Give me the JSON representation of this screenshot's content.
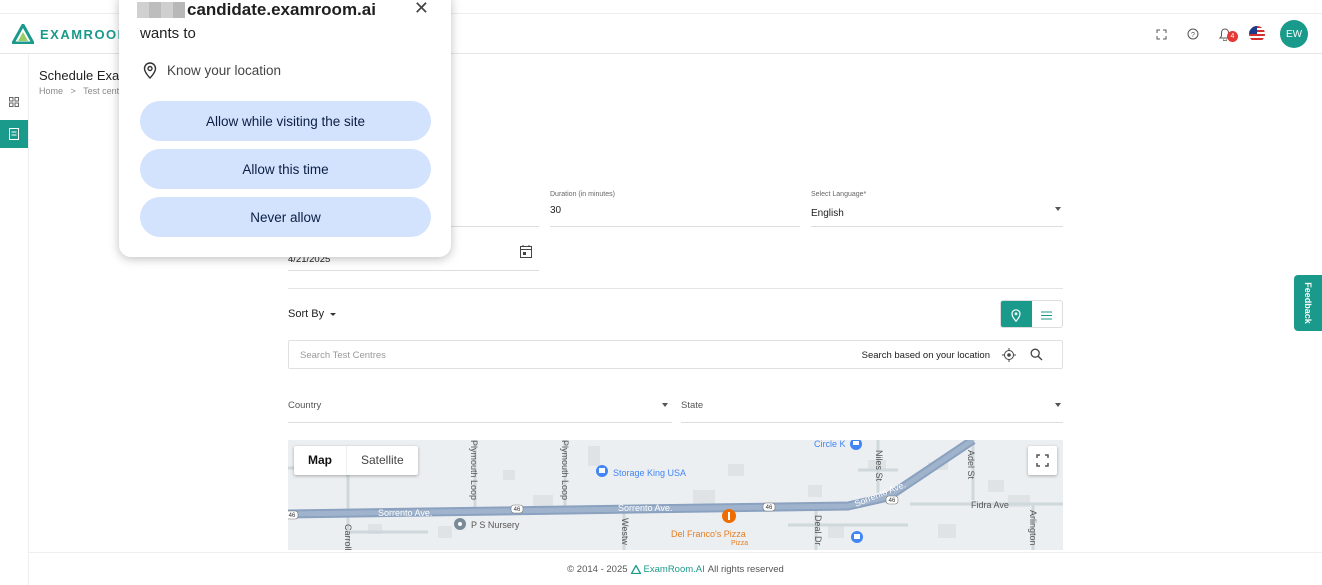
{
  "header": {
    "logo_text": "EXAMROOM",
    "avatar_initials": "EW",
    "notification_count": "4"
  },
  "page": {
    "title": "Schedule Exam",
    "breadcrumb": [
      "Home",
      "Test centre"
    ]
  },
  "form": {
    "duration_label": "Duration (in minutes)",
    "duration_value": "30",
    "language_label": "Select Language*",
    "language_value": "English",
    "date_value": "4/21/2025"
  },
  "toolbar": {
    "sort_by_label": "Sort By"
  },
  "search": {
    "placeholder": "Search Test Centres",
    "location_label": "Search based on your location"
  },
  "filters": {
    "country_label": "Country",
    "state_label": "State"
  },
  "map": {
    "tabs": [
      "Map",
      "Satellite"
    ],
    "labels": {
      "sorrento1": "Sorrento Ave.",
      "sorrento2": "Sorrento Ave.",
      "sorrento3": "Sorrento Ave.",
      "storage": "Storage King USA",
      "nursery": "P S Nursery",
      "pizza": "Del Franco's Pizza",
      "pizza_sub": "Pizza",
      "circle": "Circle K",
      "fidra": "Fidra Ave",
      "plymouth1": "Plymouth Loop",
      "plymouth2": "Plymouth Loop",
      "niles": "Niles St",
      "adel": "Adel St",
      "westw": "Westw",
      "deal": "Deal Dr",
      "arlington": "Arlington",
      "carroll": "Carroll",
      "route1": "46",
      "route2": "46",
      "route3": "46",
      "route4": "46"
    }
  },
  "footer": {
    "copyright": "© 2014 - 2025",
    "brand": "ExamRoom.AI",
    "rights": "All rights reserved"
  },
  "feedback_label": "Feedback",
  "permission_popup": {
    "origin": "candidate.examroom.ai",
    "wants_to": "wants to",
    "permission": "Know your location",
    "buttons": [
      "Allow while visiting the site",
      "Allow this time",
      "Never allow"
    ]
  },
  "colors": {
    "brand": "#1a9a8a",
    "popup_button": "#d3e3fd",
    "badge": "#e53935"
  }
}
